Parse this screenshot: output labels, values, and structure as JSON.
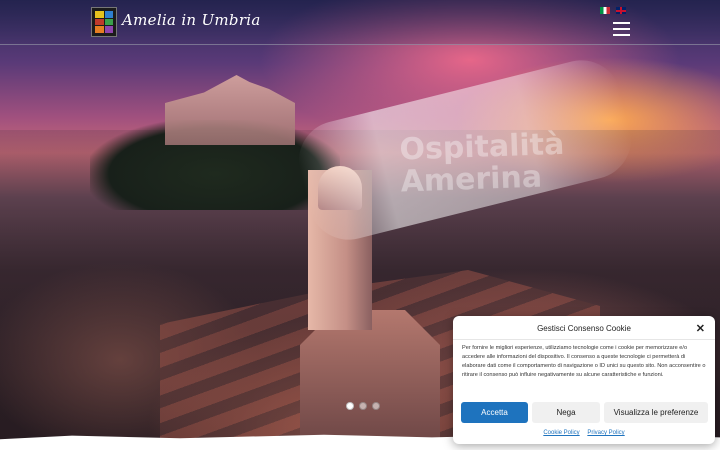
{
  "header": {
    "site_title": "Amelia in Umbria",
    "logo_colors": [
      "#e6c21e",
      "#2f7fd0",
      "#c0392b",
      "#3aa04b",
      "#e67e22",
      "#8e44ad"
    ]
  },
  "languages": [
    "it",
    "en"
  ],
  "hero": {
    "overlay_text": "Ospitalità\nAmerina",
    "slider_dots": 3,
    "active_dot": 0
  },
  "cookie": {
    "title": "Gestisci Consenso Cookie",
    "body": "Per fornire le migliori esperienze, utilizziamo tecnologie come i cookie per memorizzare e/o accedere alle informazioni del dispositivo. Il consenso a queste tecnologie ci permetterà di elaborare dati come il comportamento di navigazione o ID unici su questo sito. Non acconsentire o ritirare il consenso può influire negativamente su alcune caratteristiche e funzioni.",
    "accept_label": "Accetta",
    "deny_label": "Nega",
    "prefs_label": "Visualizza le preferenze",
    "cookie_policy_label": "Cookie Policy",
    "privacy_policy_label": "Privacy Policy",
    "accent_color": "#1e73be"
  }
}
